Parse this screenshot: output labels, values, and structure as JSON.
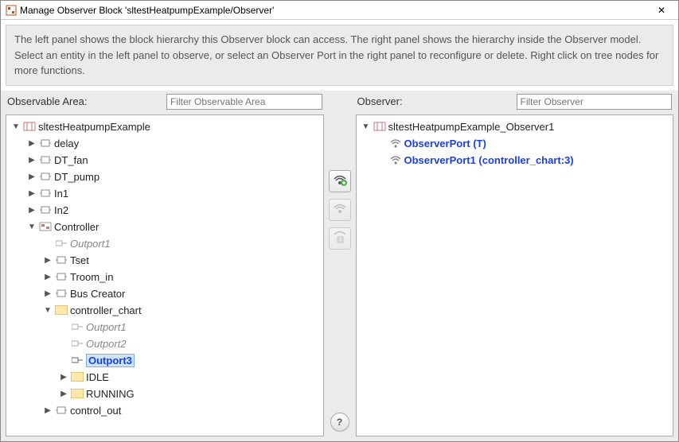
{
  "window": {
    "title": "Manage Observer Block 'sltestHeatpumpExample/Observer'"
  },
  "info": {
    "text": "The left panel shows the block hierarchy this Observer block can access. The right panel shows the hierarchy inside the Observer model. Select an entity in the left panel to observe, or select an Observer Port in the right panel to reconfigure or delete. Right click on tree nodes for more functions."
  },
  "left": {
    "header": "Observable Area:",
    "filter_placeholder": "Filter Observable Area",
    "root": "sltestHeatpumpExample",
    "n_delay": "delay",
    "n_dtfan": "DT_fan",
    "n_dtpump": "DT_pump",
    "n_in1": "In1",
    "n_in2": "In2",
    "n_controller": "Controller",
    "n_outport1": "Outport1",
    "n_tset": "Tset",
    "n_troomin": "Troom_in",
    "n_buscreator": "Bus Creator",
    "n_controller_chart": "controller_chart",
    "n_cc_outport1": "Outport1",
    "n_cc_outport2": "Outport2",
    "n_cc_outport3": "Outport3",
    "n_idle": "IDLE",
    "n_running": "RUNNING",
    "n_control_out": "control_out"
  },
  "right": {
    "header": "Observer:",
    "filter_placeholder": "Filter Observer",
    "root": "sltestHeatpumpExample_Observer1",
    "port1": "ObserverPort (T)",
    "port2": "ObserverPort1 (controller_chart:3)"
  },
  "icons": {
    "close": "✕",
    "help": "?"
  }
}
